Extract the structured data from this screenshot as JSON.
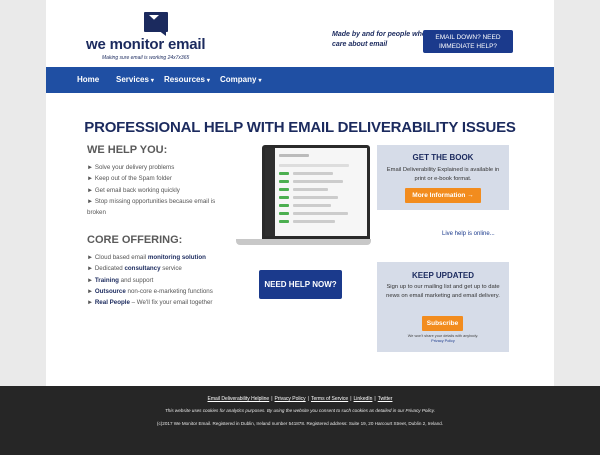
{
  "header": {
    "logo_text": "we monitor email",
    "logo_tagline": "Making sure email is working 24x7x365",
    "tagline": "Made by and for people who care about email",
    "email_down_button": "EMAIL DOWN? NEED IMMEDIATE HELP?"
  },
  "nav": {
    "items": [
      {
        "label": "Home"
      },
      {
        "label": "Services"
      },
      {
        "label": "Resources"
      },
      {
        "label": "Company"
      }
    ]
  },
  "main": {
    "headline": "PROFESSIONAL HELP WITH EMAIL DELIVERABILITY ISSUES",
    "we_help": {
      "title": "WE HELP YOU:",
      "items": [
        "Solve your delivery problems",
        "Keep out of the Spam folder",
        "Get email back working quickly",
        "Stop missing opportunities because email is broken"
      ]
    },
    "core": {
      "title": "CORE OFFERING:",
      "items": [
        {
          "pre": "Cloud based email ",
          "strong": "monitoring solution",
          "post": ""
        },
        {
          "pre": "Dedicated ",
          "strong": "consultancy",
          "post": " service"
        },
        {
          "pre": "",
          "strong": "Training",
          "post": " and support"
        },
        {
          "pre": "",
          "strong": "Outsource",
          "post": " non-core e-marketing functions"
        },
        {
          "pre": "",
          "strong": "Real People",
          "post": " – We'll fix your email together"
        }
      ]
    },
    "need_help_button": "NEED HELP NOW?",
    "live_help": "Live help is online..."
  },
  "book_box": {
    "title": "GET THE BOOK",
    "text": "Email Deliverability Explained is available in print or e-book format.",
    "button": "More Information →"
  },
  "updates_box": {
    "title": "KEEP UPDATED",
    "text": "Sign up to our mailing list and get up to date news on email marketing and email delivery.",
    "button": "Subscribe",
    "note": "We won't share your details with anybody.",
    "policy_link": "Privacy Policy"
  },
  "footer": {
    "links": [
      "Email Deliverability Helpline",
      "Privacy Policy",
      "Terms of Service",
      "LinkedIn",
      "Twitter"
    ],
    "cookie_text": "This website uses cookies for analytics purposes. By using the website you consent to such cookies as detailed in our Privacy Policy.",
    "legal_text": "(c)2017 We Monitor Email. Registered in Dublin, Ireland number 541878. Registered address: Suite 19, 20 Harcourt Street, Dublin 2, Ireland."
  },
  "colors": {
    "brand_navy": "#1b2a5e",
    "nav_blue": "#1f4fa3",
    "button_blue": "#1b3a8c",
    "accent_orange": "#f28c1e",
    "box_bg": "#d6dce8",
    "footer_bg": "#262626"
  }
}
